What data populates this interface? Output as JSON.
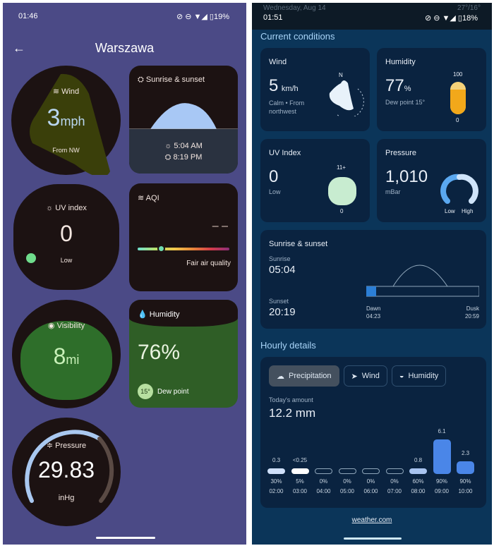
{
  "left": {
    "status": {
      "time": "01:46",
      "battery": "19%"
    },
    "title": "Warszawa",
    "wind": {
      "label": "Wind",
      "value": "3",
      "unit": "mph",
      "dir": "From NW"
    },
    "sun": {
      "label": "Sunrise & sunset",
      "sunrise": "5:04 AM",
      "sunset": "8:19 PM"
    },
    "uv": {
      "label": "UV index",
      "value": "0",
      "level": "Low"
    },
    "aqi": {
      "label": "AQI",
      "value": "– –",
      "desc": "Fair air quality"
    },
    "visibility": {
      "label": "Visibility",
      "value": "8",
      "unit": "mi"
    },
    "humidity": {
      "label": "Humidity",
      "value": "76%",
      "dew": "15°",
      "dew_label": "Dew point"
    },
    "pressure": {
      "label": "Pressure",
      "value": "29.83",
      "unit": "inHg"
    }
  },
  "right": {
    "status": {
      "date": "Wednesday, Aug 14",
      "time": "01:51",
      "temps": "27°/16°",
      "battery": "18%"
    },
    "section1": "Current conditions",
    "wind": {
      "label": "Wind",
      "value": "5",
      "unit": "km/h",
      "desc1": "Calm • From",
      "desc2": "northwest",
      "north": "N"
    },
    "humidity": {
      "label": "Humidity",
      "value": "77",
      "unit": "%",
      "dew": "Dew point 15°",
      "max": "100",
      "min": "0",
      "fill": 0.77
    },
    "uv": {
      "label": "UV Index",
      "value": "0",
      "level": "Low",
      "max": "11+",
      "min": "0"
    },
    "pressure": {
      "label": "Pressure",
      "value": "1,010",
      "unit": "mBar",
      "low": "Low",
      "high": "High"
    },
    "sun": {
      "label": "Sunrise & sunset",
      "sunrise_label": "Sunrise",
      "sunrise": "05:04",
      "sunset_label": "Sunset",
      "sunset": "20:19",
      "dawn_label": "Dawn",
      "dawn": "04:23",
      "dusk_label": "Dusk",
      "dusk": "20:59"
    },
    "section2": "Hourly details",
    "tabs": [
      "Precipitation",
      "Wind",
      "Humidity"
    ],
    "today_label": "Today's amount",
    "today_value": "12.2 mm",
    "hours": [
      {
        "amt": "0.3",
        "v": 0.3,
        "pct": "30%",
        "t": "02:00"
      },
      {
        "amt": "<0.25",
        "v": 0.25,
        "pct": "5%",
        "t": "03:00"
      },
      {
        "amt": "",
        "v": 0,
        "pct": "0%",
        "t": "04:00"
      },
      {
        "amt": "",
        "v": 0,
        "pct": "0%",
        "t": "05:00"
      },
      {
        "amt": "",
        "v": 0,
        "pct": "0%",
        "t": "06:00"
      },
      {
        "amt": "",
        "v": 0,
        "pct": "0%",
        "t": "07:00"
      },
      {
        "amt": "0.8",
        "v": 0.8,
        "pct": "60%",
        "t": "08:00"
      },
      {
        "amt": "6.1",
        "v": 6.1,
        "pct": "90%",
        "t": "09:00"
      },
      {
        "amt": "2.3",
        "v": 2.3,
        "pct": "90%",
        "t": "10:00"
      }
    ],
    "source": "weather.com"
  }
}
